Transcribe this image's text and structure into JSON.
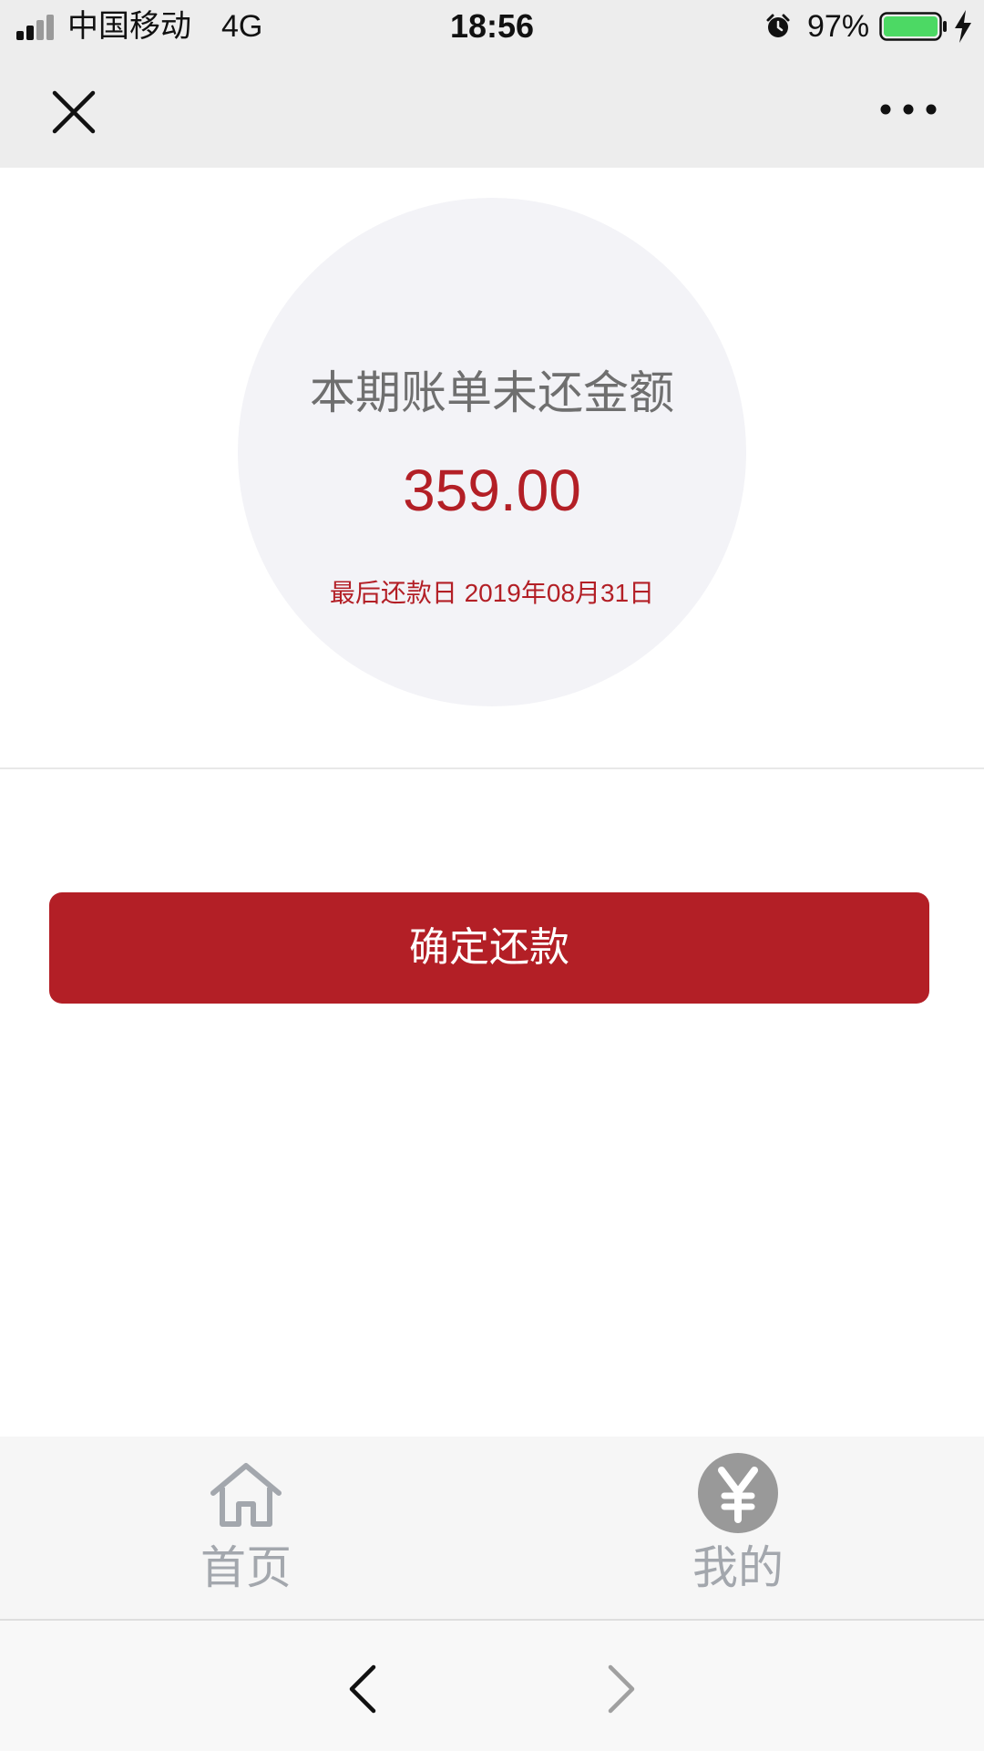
{
  "status_bar": {
    "carrier": "中国移动",
    "network": "4G",
    "time": "18:56",
    "battery_percent": "97%",
    "icons": [
      "signal-icon",
      "alarm-icon",
      "battery-icon",
      "charging-icon"
    ]
  },
  "nav_bar": {
    "close_icon": "close-icon",
    "more_icon": "more-icon"
  },
  "summary": {
    "title": "本期账单未还金额",
    "amount": "359.00",
    "due_date_text": "最后还款日 2019年08月31日"
  },
  "actions": {
    "confirm_label": "确定还款"
  },
  "tabs": [
    {
      "label": "首页",
      "icon": "home-icon"
    },
    {
      "label": "我的",
      "icon": "yen-icon"
    }
  ],
  "browser_toolbar": {
    "back_icon": "back-arrow-icon",
    "forward_icon": "forward-arrow-icon"
  },
  "colors": {
    "accent": "#b31f26",
    "status_bar_bg": "#ededed",
    "circle_bg": "#f3f3f7",
    "tab_label": "#a3a7ad",
    "battery_fill": "#4cd964"
  }
}
